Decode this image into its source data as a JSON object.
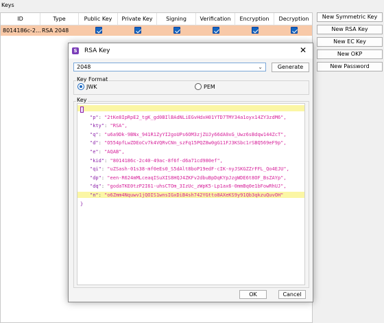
{
  "main": {
    "title": "Keys",
    "columns": [
      "ID",
      "Type",
      "Public Key",
      "Private Key",
      "Signing",
      "Verification",
      "Encryption",
      "Decryption"
    ],
    "rows": [
      {
        "id": "8014186c-2…",
        "type": "RSA 2048",
        "flags": [
          true,
          true,
          true,
          true,
          true,
          true
        ]
      }
    ],
    "buttons": [
      "New Symmetric Key",
      "New RSA Key",
      "New EC Key",
      "New OKP",
      "New Password"
    ]
  },
  "dialog": {
    "title": "RSA Key",
    "key_size": "2048",
    "generate_label": "Generate",
    "format_label": "Key Format",
    "format_options": [
      "JWK",
      "PEM"
    ],
    "format_selected": "JWK",
    "key_label": "Key",
    "key_json": [
      {
        "name": "p",
        "value": "2tKe8IpRpE2_tgK_gd0BIlBAdNLiEGvHdxH01YTD7TMY34a1oyx14ZY3zdM6"
      },
      {
        "name": "kty",
        "value": "RSA"
      },
      {
        "name": "q",
        "value": "u6a9Dk-9BNx_941R1ZyYI2goUPs6OM3zjZUJy66dA0xG_Uwz6sBdqw144ZcT"
      },
      {
        "name": "d",
        "value": "O554pfLwZDEoCv7k4VQRvCNn_szFq15PQZ8w0gG11FJ3KSbc1rSBQ569eF9p"
      },
      {
        "name": "e",
        "value": "AQAB"
      },
      {
        "name": "kid",
        "value": "8014186c-2c40-49ac-8f6f-d6a71cd980ef"
      },
      {
        "name": "qi",
        "value": "uZSash-01s38-mf0eEs0_S5dAlt8boP19edF-cIK-nyJSKGZZrFFL_Qo4EJU"
      },
      {
        "name": "dp",
        "value": "een-R624mMLceaqISuXIS8HQJ4ZKFv2dbuBpDqKYpJzgWDE6t8OF_BsZAYp"
      },
      {
        "name": "dq",
        "value": "godaTKE0tzP2I61-uhsCTOm_3IzUc_zWpK5-Lp1ax6-0mmBq0e1bFowRhUJ"
      },
      {
        "name": "n",
        "value": "o6Zmm4Nquwv1jQOIS1wnsIGxDiB4sh742YGtto8AXeKS9y91Qb3qkzuQuvOH"
      }
    ],
    "ok_label": "OK",
    "cancel_label": "Cancel"
  },
  "colors": {
    "row_selected": "#f8c9a8",
    "checkbox": "#1565c0",
    "json_key": "#8b1fa9",
    "json_string": "#d6209a",
    "current_line": "#fbf6a4"
  },
  "icons": [
    "checkbox-checked-icon",
    "app-icon",
    "close-icon",
    "chevron-down-icon",
    "radio-checked-icon",
    "radio-unchecked-icon"
  ]
}
